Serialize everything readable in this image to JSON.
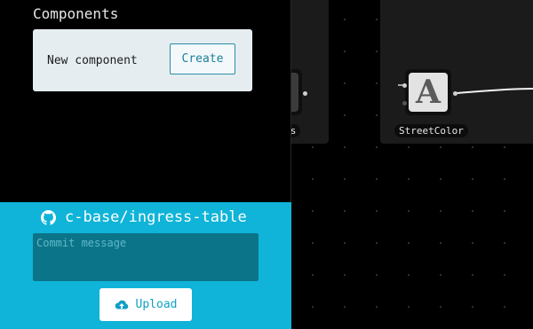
{
  "sidebar": {
    "title": "Components",
    "new_component": {
      "label": "New component",
      "create_label": "Create"
    }
  },
  "github": {
    "repo": "c-base/ingress-table",
    "commit_placeholder": "Commit message",
    "commit_value": "",
    "upload_label": "Upload",
    "upload_icon": "cloud-upload-icon",
    "repo_icon": "github-icon"
  },
  "graph": {
    "nodes": [
      {
        "label": "...tors",
        "icon": "component-icon"
      },
      {
        "label": "StreetColor",
        "icon": "letter-a-icon",
        "glyph": "A"
      }
    ]
  },
  "colors": {
    "accent": "#0fb4d8",
    "commit_bg": "#0b7488",
    "button_text": "#1a7f99"
  }
}
